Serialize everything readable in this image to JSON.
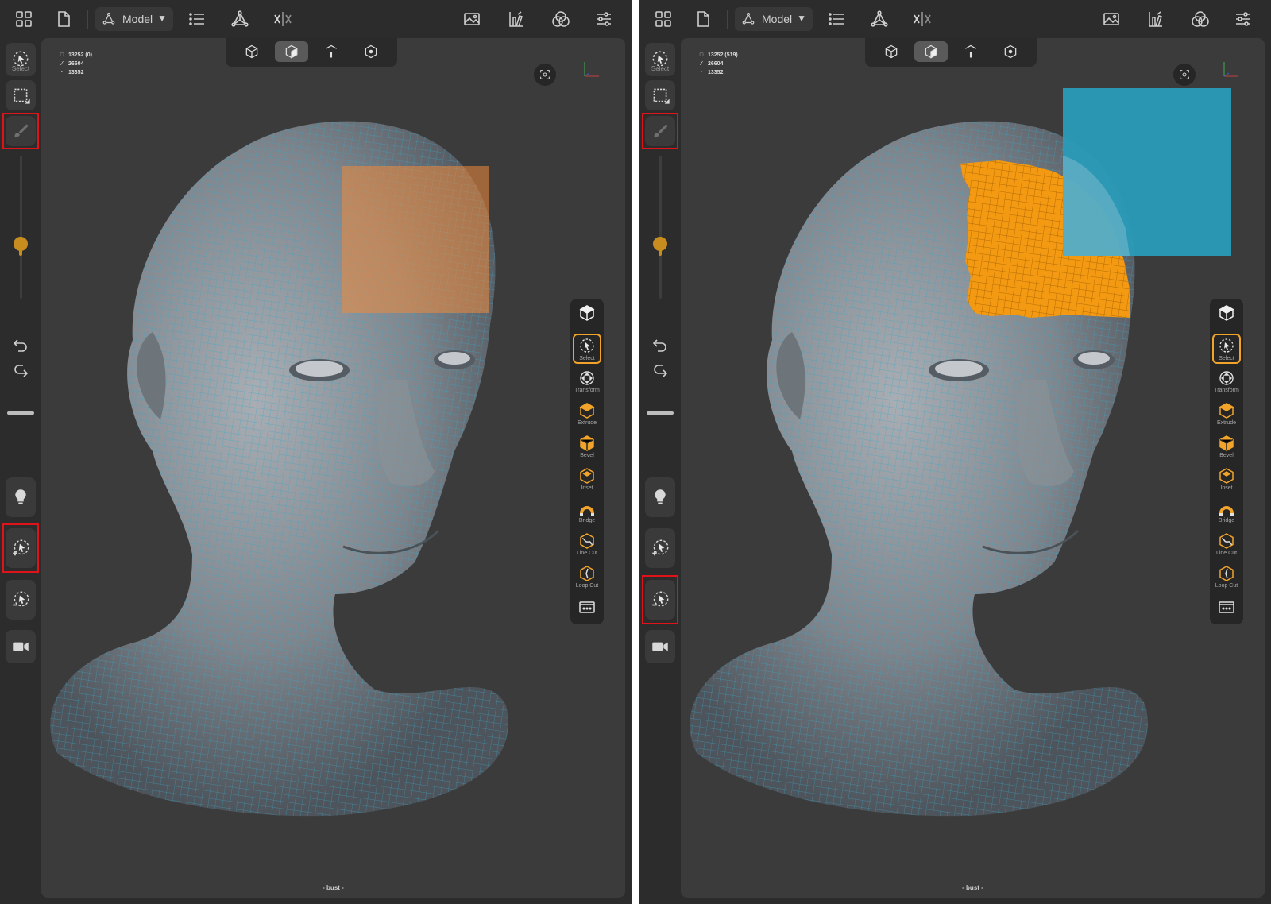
{
  "panels": [
    {
      "id": "before",
      "toolbar": {
        "mode_label": "Model",
        "icons": [
          "grid-icon",
          "document-icon",
          "model-mode-icon",
          "list-icon",
          "topology-icon",
          "symmetry-icon",
          "image-icon",
          "color-swatch-icon",
          "material-icon",
          "settings-sliders-icon"
        ]
      },
      "left": {
        "select_caption": "Select",
        "icons": [
          "select-tool-icon",
          "marquee-icon",
          "brush-icon",
          "undo-icon",
          "redo-icon",
          "light-bulb-icon",
          "add-selection-icon",
          "subtract-selection-icon",
          "camera-icon"
        ]
      },
      "stats": {
        "faces": "13252 (0)",
        "edges": "26604",
        "vertices": "13352"
      },
      "selection_types": [
        "object",
        "face",
        "edge",
        "vertex"
      ],
      "active_selection_type": "face",
      "right_tools": [
        {
          "label": ""
        },
        {
          "label": "Select"
        },
        {
          "label": "Transform"
        },
        {
          "label": "Extrude"
        },
        {
          "label": "Bevel"
        },
        {
          "label": "Inset"
        },
        {
          "label": "Bridge"
        },
        {
          "label": "Line Cut"
        },
        {
          "label": "Loop Cut"
        },
        {
          "label": ""
        }
      ],
      "bottom_label": "- bust -",
      "overlay_color": "#f08a3a",
      "highlighted": [
        "brush-tool",
        "add-selection"
      ]
    },
    {
      "id": "after",
      "toolbar": {
        "mode_label": "Model"
      },
      "left": {
        "select_caption": "Select"
      },
      "stats": {
        "faces": "13252 (519)",
        "edges": "26604",
        "vertices": "13352"
      },
      "right_tools": [
        {
          "label": ""
        },
        {
          "label": "Select"
        },
        {
          "label": "Transform"
        },
        {
          "label": "Extrude"
        },
        {
          "label": "Bevel"
        },
        {
          "label": "Inset"
        },
        {
          "label": "Bridge"
        },
        {
          "label": "Line Cut"
        },
        {
          "label": "Loop Cut"
        },
        {
          "label": ""
        }
      ],
      "bottom_label": "- bust -",
      "overlay_color": "#2a9bb8",
      "selected_face_color": "#f39a12",
      "highlighted": [
        "brush-tool",
        "subtract-selection"
      ]
    }
  ],
  "colors": {
    "accent": "#f1a32a",
    "highlight_box": "#e0121a",
    "wire": "#3aa6c8"
  }
}
